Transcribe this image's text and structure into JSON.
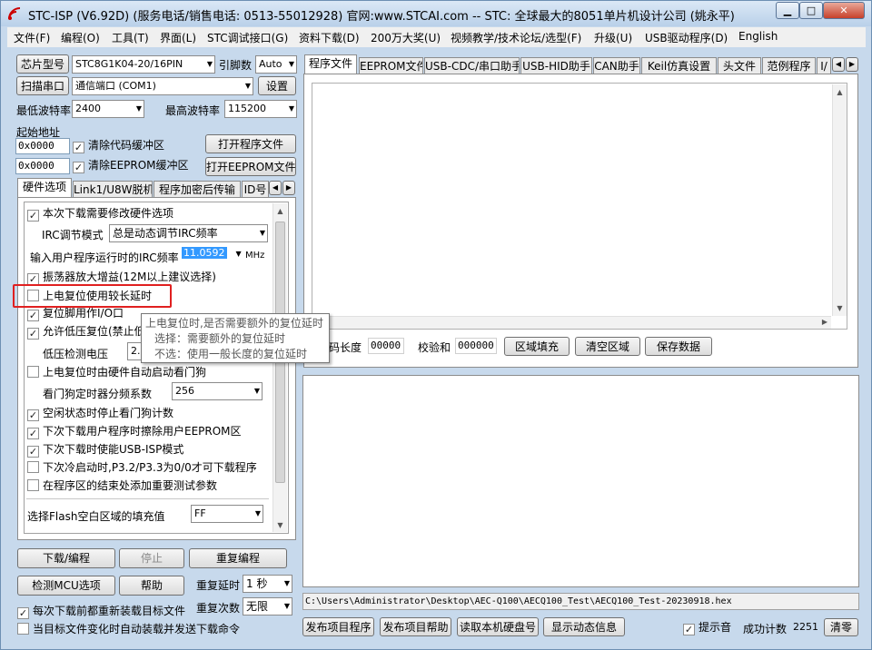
{
  "window": {
    "title": "STC-ISP (V6.92D) (服务电话/销售电话: 0513-55012928) 官网:www.STCAI.com  -- STC: 全球最大的8051单片机设计公司 (姚永平)",
    "min": "▁",
    "max": "□",
    "close": "✕"
  },
  "menu": [
    "文件(F)",
    "编程(O)",
    "工具(T)",
    "界面(L)",
    "STC调试接口(G)",
    "资料下载(D)",
    "200万大奖(U)",
    "视频教学/技术论坛/选型(F)",
    "升级(U)",
    "USB驱动程序(D)",
    "English"
  ],
  "left": {
    "chip_type_btn": "芯片型号",
    "chip_value": "STC8G1K04-20/16PIN",
    "pins_label": "引脚数",
    "pins_value": "Auto",
    "scan_btn": "扫描串口",
    "port_value": "通信端口 (COM1)",
    "settings_btn": "设置",
    "min_baud_label": "最低波特率",
    "min_baud": "2400",
    "max_baud_label": "最高波特率",
    "max_baud": "115200",
    "start_addr_label": "起始地址",
    "addr1": "0x0000",
    "clear_code": "清除代码缓冲区",
    "open_prog": "打开程序文件",
    "addr2": "0x0000",
    "clear_eeprom": "清除EEPROM缓冲区",
    "open_eeprom": "打开EEPROM文件",
    "tabs": [
      "硬件选项",
      "Link1/U8W脱机",
      "程序加密后传输",
      "ID号"
    ],
    "options": {
      "opt1": "本次下载需要修改硬件选项",
      "irc_mode_label": "IRC调节模式",
      "irc_mode": "总是动态调节IRC频率",
      "irc_freq_label": "输入用户程序运行时的IRC频率",
      "irc_freq": "11.0592",
      "mhz": "MHz",
      "opt2": "振荡器放大增益(12M以上建议选择)",
      "opt3": "上电复位使用较长延时",
      "opt4": "复位脚用作I/O口",
      "opt5": "允许低压复位(禁止低压中断)",
      "lvd_label": "低压检测电压",
      "lvd_value": "2.",
      "opt6": "上电复位时由硬件自动启动看门狗",
      "wdt_label": "看门狗定时器分频系数",
      "wdt_value": "256",
      "opt7": "空闲状态时停止看门狗计数",
      "opt8": "下次下载用户程序时擦除用户EEPROM区",
      "opt9": "下次下载时使能USB-ISP模式",
      "opt10": "下次冷启动时,P3.2/P3.3为0/0才可下载程序",
      "opt11": "在程序区的结束处添加重要测试参数",
      "fill_label": "选择Flash空白区域的填充值",
      "fill_value": "FF"
    },
    "download_btn": "下载/编程",
    "stop_btn": "停止",
    "reprogram_btn": "重复编程",
    "check_mcu_btn": "检测MCU选项",
    "help_btn": "帮助",
    "repeat_delay_label": "重复延时",
    "repeat_delay": "1 秒",
    "repeat_count_label": "重复次数",
    "repeat_count": "无限",
    "reload_each": "每次下载前都重新装载目标文件",
    "auto_load": "当目标文件变化时自动装载并发送下载命令"
  },
  "tooltip": {
    "line1": "上电复位时,是否需要额外的复位延时",
    "line2": "选择：需要额外的复位延时",
    "line3": "不选：使用一般长度的复位延时"
  },
  "right": {
    "tabs": [
      "程序文件",
      "EEPROM文件",
      "USB-CDC/串口助手",
      "USB-HID助手",
      "CAN助手",
      "Keil仿真设置",
      "头文件",
      "范例程序",
      "I/"
    ],
    "code_len_label": "代码长度",
    "code_len": "00000",
    "checksum_label": "校验和",
    "checksum": "000000",
    "fill_area_btn": "区域填充",
    "clear_area_btn": "清空区域",
    "save_data_btn": "保存数据",
    "file_path": "C:\\Users\\Administrator\\Desktop\\AEC-Q100\\AECQ100_Test\\AECQ100_Test-20230918.hex",
    "publish_prog_btn": "发布项目程序",
    "publish_help_btn": "发布项目帮助",
    "read_disk_btn": "读取本机硬盘号",
    "show_anim_btn": "显示动态信息",
    "beep_label": "提示音",
    "success_label": "成功计数",
    "success_count": "2251",
    "clear_btn": "清零"
  }
}
